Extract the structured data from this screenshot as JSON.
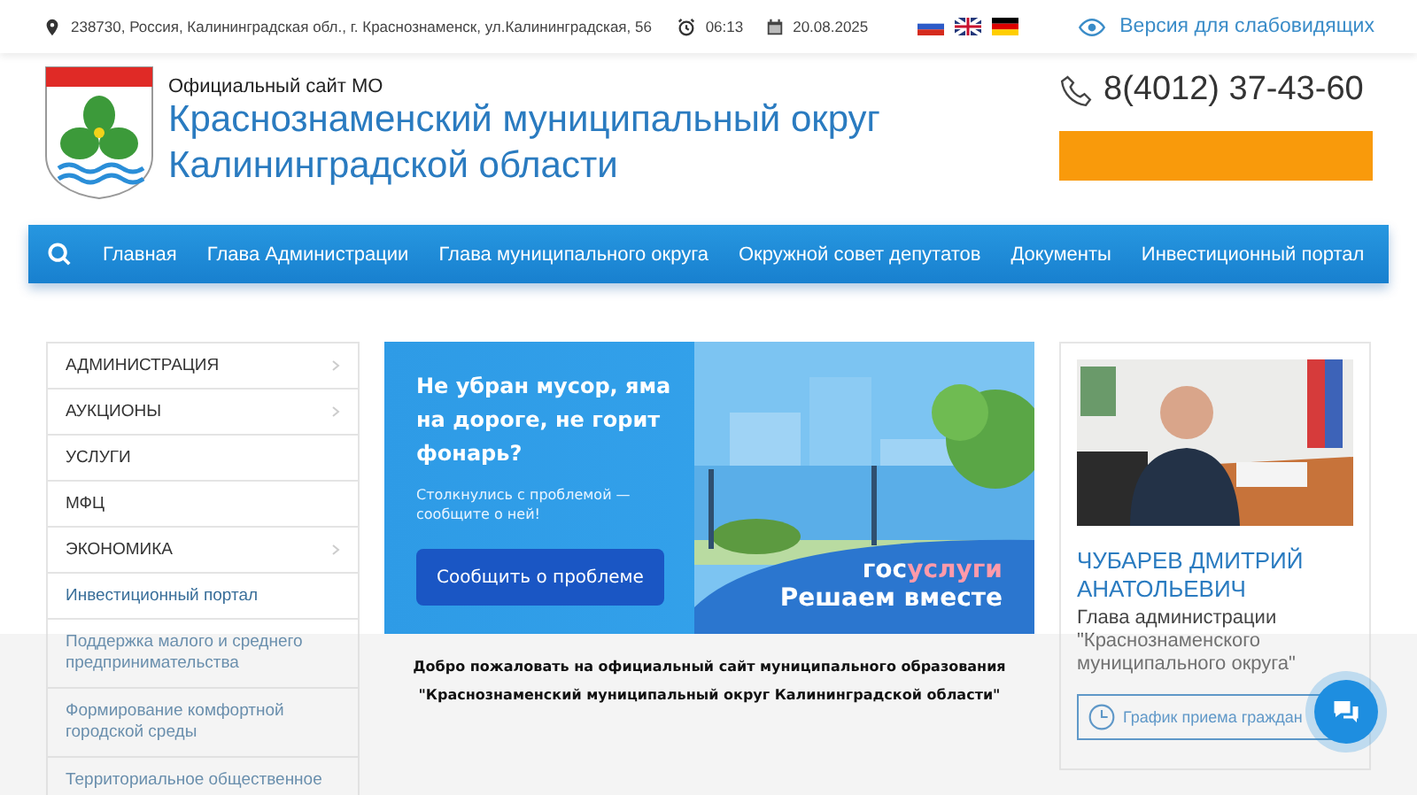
{
  "top_bar": {
    "address": "238730, Россия, Калининградская обл., г. Краснознаменск, ул.Калининградская, 56",
    "time": "06:13",
    "date": "20.08.2025",
    "accessibility_link": "Версия для слабовидящих"
  },
  "header": {
    "subtitle": "Официальный сайт МО",
    "title": "Краснознаменский муниципальный округ Калининградской области",
    "phone": "8(4012) 37-43-60"
  },
  "nav": {
    "items": [
      "Главная",
      "Глава Администрации",
      "Глава муниципального округа",
      "Окружной совет депутатов",
      "Документы",
      "Инвестиционный портал"
    ]
  },
  "sidebar": {
    "items": [
      {
        "label": "АДМИНИСТРАЦИЯ",
        "submenu": true
      },
      {
        "label": "АУКЦИОНЫ",
        "submenu": true
      },
      {
        "label": "УСЛУГИ",
        "submenu": false
      },
      {
        "label": "МФЦ",
        "submenu": false
      },
      {
        "label": "ЭКОНОМИКА",
        "submenu": true
      },
      {
        "label": "Инвестиционный портал",
        "submenu": false
      },
      {
        "label": "Поддержка малого и среднего предпринимательства",
        "submenu": false
      },
      {
        "label": "Формирование комфортной городской среды",
        "submenu": false
      },
      {
        "label": "Территориальное общественное",
        "submenu": false
      }
    ]
  },
  "banner": {
    "headline": "Не убран мусор, яма на дороге, не горит фонарь?",
    "text": "Столкнулись с проблемой — сообщите о ней!",
    "button": "Сообщить о проблеме",
    "brand_prefix": "гос",
    "brand_suffix": "услуги",
    "slogan": "Решаем вместе"
  },
  "welcome": {
    "line_1": "Добро пожаловать на официальный сайт муниципального образования",
    "line_2": "\"Краснознаменский муниципальный округ Калининградской области\""
  },
  "head_card": {
    "name": "ЧУБАРЕВ ДМИТРИЙ АНАТОЛЬЕВИЧ",
    "position": "Глава администрации \"Краснознаменского муниципального округа\"",
    "schedule_button": "График приема граждан"
  }
}
